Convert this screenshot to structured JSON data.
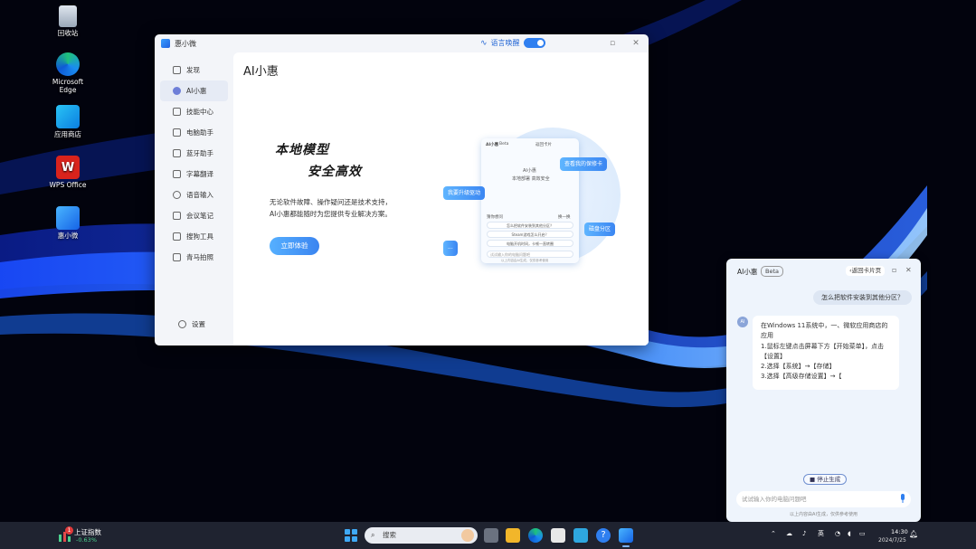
{
  "desktop": {
    "icons": [
      {
        "label": "回收站"
      },
      {
        "label": "Microsoft Edge"
      },
      {
        "label": "应用商店"
      },
      {
        "label": "WPS Office"
      },
      {
        "label": "惠小微"
      }
    ]
  },
  "main_window": {
    "title": "惠小微",
    "language_wake_label": "语言唤醒",
    "language_wake_enabled": true,
    "sidebar": {
      "items": [
        {
          "label": "发现",
          "icon": "discover-icon"
        },
        {
          "label": "AI小惠",
          "icon": "ai-icon",
          "active": true
        },
        {
          "label": "技能中心",
          "icon": "skills-icon"
        },
        {
          "label": "电脑助手",
          "icon": "computer-icon"
        },
        {
          "label": "蓝牙助手",
          "icon": "bluetooth-icon"
        },
        {
          "label": "字幕翻译",
          "icon": "subtitle-icon"
        },
        {
          "label": "语音输入",
          "icon": "voice-icon"
        },
        {
          "label": "会议笔记",
          "icon": "notes-icon"
        },
        {
          "label": "搜狗工具",
          "icon": "tools-icon"
        },
        {
          "label": "青马拍照",
          "icon": "camera-icon"
        }
      ],
      "settings_label": "设置"
    },
    "content": {
      "page_title": "AI小惠",
      "hero_line1": "本地模型",
      "hero_line2": "安全高效",
      "desc_line1": "无论软件故障、操作疑问还是技术支持，",
      "desc_line2": "AI小惠都能随时为您提供专业解决方案。",
      "try_button": "立即体验",
      "illustration": {
        "panel_title": "AI小惠",
        "panel_tag": "Beta",
        "panel_back": "返回卡片",
        "panel_heading": "AI小惠",
        "panel_sub": "本地部署 高效安全",
        "recommend_label": "猜你想问",
        "refresh_label": "换一换",
        "bubbles": [
          "怎么把软件安装到其他分区？",
          "Steam游戏怎么开启？",
          "电脑开机时间，卡顿一直转圈"
        ],
        "input_placeholder": "试试输入你的电脑问题吧",
        "footer": "以上内容由AI生成，仅供参考使用",
        "tag_1": "查看我的保修卡",
        "tag_2": "我要升级驱动",
        "tag_3": "磁盘分区",
        "tag_4": "..."
      }
    }
  },
  "chat_panel": {
    "title": "AI小惠",
    "beta": "Beta",
    "back_button": "返回卡片页",
    "user_message": "怎么把软件安装到其他分区？",
    "avatar_text": "AI",
    "answer_lines": [
      "在Windows 11系统中，一、微软应用商店的",
      "应用",
      "1.鼠标左键点击屏幕下方【开始菜单】，点击",
      "【设置】",
      "2.选择【系统】→【存储】",
      "3.选择【高级存储设置】→【"
    ],
    "stop_button": "停止生成",
    "input_placeholder": "试试输入你的电脑问题吧",
    "footer": "以上内容由AI生成，仅供参考使用"
  },
  "taskbar": {
    "stock_name": "上证指数",
    "stock_change": "-0.63%",
    "stock_badge": "1",
    "search_placeholder": "搜索",
    "ime_label": "英",
    "time": "14:30",
    "date": "2024/7/25"
  },
  "colors": {
    "accent": "#2f7ff0",
    "taskbar": "#1f2330",
    "stock_change": "#4bd18d"
  }
}
